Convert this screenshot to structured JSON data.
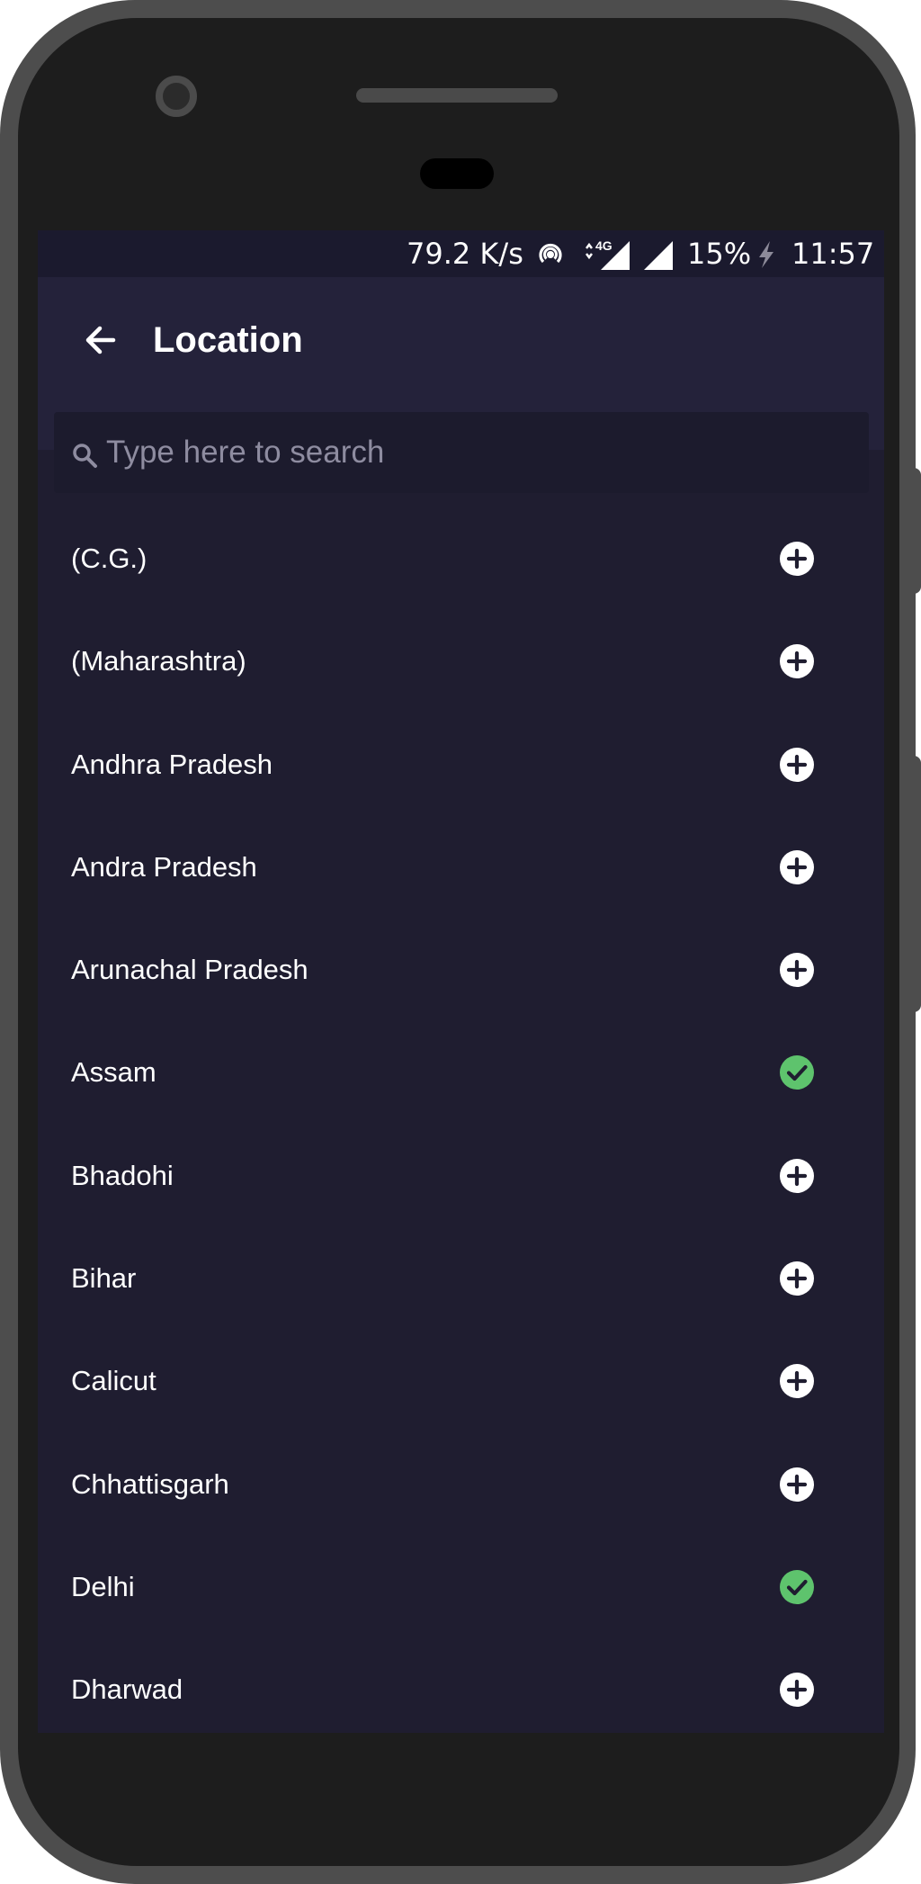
{
  "status_bar": {
    "net_speed": "79.2 K/s",
    "network_type": "4G",
    "battery": "15%",
    "time": "11:57",
    "icons": [
      "hotspot-icon",
      "data-arrows-icon",
      "signal-icon",
      "signal-icon",
      "charging-icon"
    ]
  },
  "header": {
    "title": "Location",
    "back_icon": "arrow-left-icon"
  },
  "search": {
    "placeholder": "Type here to search",
    "value": "",
    "icon": "search-icon"
  },
  "locations": [
    {
      "label": "(C.G.)",
      "state": "add"
    },
    {
      "label": "(Maharashtra)",
      "state": "add"
    },
    {
      "label": "Andhra Pradesh",
      "state": "add"
    },
    {
      "label": "Andra Pradesh",
      "state": "add"
    },
    {
      "label": "Arunachal Pradesh",
      "state": "add"
    },
    {
      "label": "Assam",
      "state": "selected"
    },
    {
      "label": "Bhadohi",
      "state": "add"
    },
    {
      "label": "Bihar",
      "state": "add"
    },
    {
      "label": "Calicut",
      "state": "add"
    },
    {
      "label": "Chhattisgarh",
      "state": "add"
    },
    {
      "label": "Delhi",
      "state": "selected"
    },
    {
      "label": "Dharwad",
      "state": "add"
    }
  ],
  "colors": {
    "screen_bg": "#1f1d30",
    "app_bar_bg": "#24223a",
    "selected": "#5ec36d",
    "add_icon_bg": "#ffffff"
  }
}
